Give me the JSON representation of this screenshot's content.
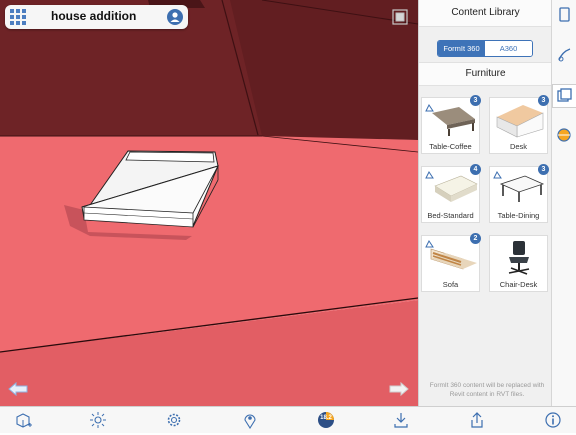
{
  "document": {
    "title": "house addition"
  },
  "panel": {
    "header_title": "Content Library",
    "segments": [
      {
        "label": "FormIt 360",
        "selected": true
      },
      {
        "label": "A360",
        "selected": false
      }
    ],
    "category": "Furniture",
    "items": [
      {
        "label": "Table-Coffee",
        "count": "3",
        "icon": "coffee-table-thumbnail"
      },
      {
        "label": "Desk",
        "count": "3",
        "icon": "desk-thumbnail"
      },
      {
        "label": "Bed-Standard",
        "count": "4",
        "icon": "bed-thumbnail"
      },
      {
        "label": "Table-Dining",
        "count": "3",
        "icon": "dining-table-thumbnail"
      },
      {
        "label": "Sofa",
        "count": "2",
        "icon": "sofa-thumbnail"
      },
      {
        "label": "Chair-Desk",
        "count": "",
        "icon": "desk-chair-thumbnail"
      }
    ],
    "footer_note": "FormIt 360 content will be replaced with Revit content in RVT files."
  },
  "side_tabs": [
    {
      "icon": "tablet-properties-icon",
      "active": false
    },
    {
      "icon": "brush-materials-icon",
      "active": false
    },
    {
      "icon": "content-library-icon",
      "active": true
    },
    {
      "icon": "globe-layers-icon",
      "active": false
    }
  ],
  "toolbar": [
    "add-cube-icon",
    "sun-light-icon",
    "settings-gear-icon",
    "location-pin-icon",
    "level-badge-icon",
    "import-download-icon",
    "share-upload-icon",
    "info-icon"
  ],
  "level_badge": "18.2",
  "colors": {
    "accent": "#3d6fb0",
    "floor": "#ef6a6f",
    "wall": "#6e2326",
    "wall_dark": "#5a1b1e",
    "panel_bg": "#f0f0f0"
  }
}
